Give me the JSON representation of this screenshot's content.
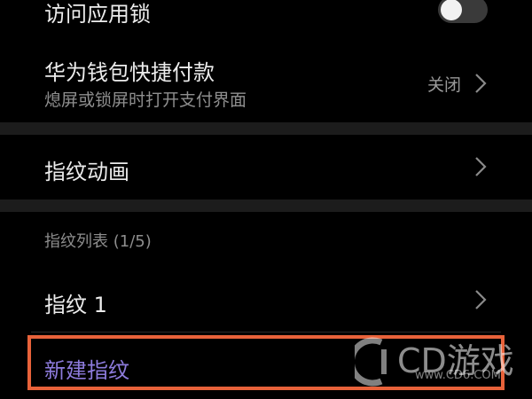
{
  "settings": {
    "app_lock": {
      "label": "访问应用锁",
      "toggle_on": false
    },
    "wallet": {
      "title": "华为钱包快捷付款",
      "subtitle": "熄屏或锁屏时打开支付界面",
      "value": "关闭"
    },
    "fingerprint_animation": {
      "label": "指纹动画"
    },
    "fingerprint_list": {
      "header": "指纹列表 (1/5)",
      "items": [
        {
          "label": "指纹 1"
        }
      ],
      "new_label": "新建指纹"
    }
  },
  "watermark": {
    "brand": "CD游戏",
    "url": "www.CD6.COM"
  },
  "colors": {
    "background": "#000000",
    "separator": "#1c1c1c",
    "accent_purple": "#8d7bdc",
    "highlight_orange": "#e8623a",
    "toggle_track": "#3a3a3a"
  }
}
